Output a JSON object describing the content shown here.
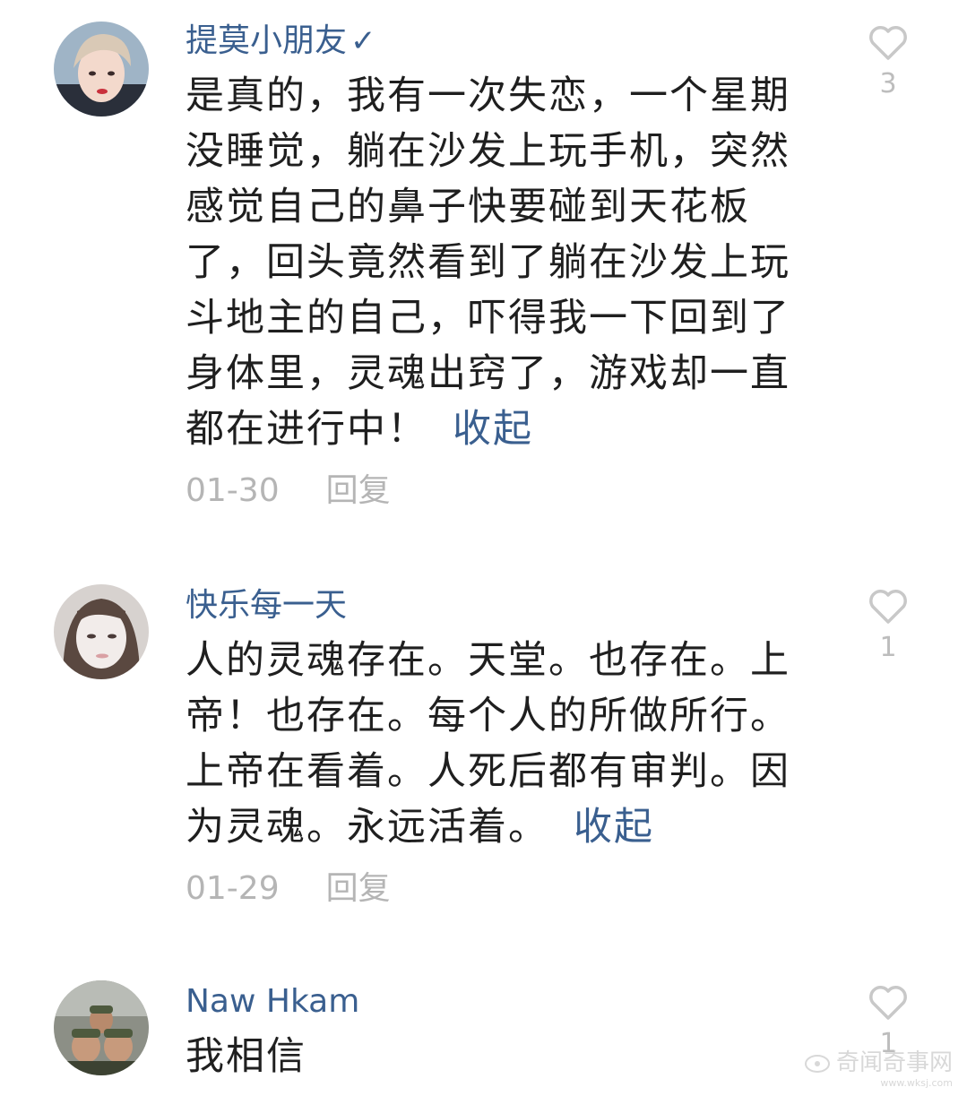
{
  "comments": [
    {
      "username": "提莫小朋友",
      "verified_mark": "✓",
      "text": "是真的，我有一次失恋，一个星期没睡觉，躺在沙发上玩手机，突然感觉自己的鼻子快要碰到天花板了，回头竟然看到了躺在沙发上玩斗地主的自己，吓得我一下回到了身体里，灵魂出窍了，游戏却一直都在进行中！",
      "collapse_label": "收起",
      "date": "01-30",
      "reply_label": "回复",
      "like_count": "3",
      "like_icon": "heart-outline-icon"
    },
    {
      "username": "快乐每一天",
      "text": "人的灵魂存在。天堂。也存在。上帝！也存在。每个人的所做所行。上帝在看着。人死后都有审判。因为灵魂。永远活着。",
      "collapse_label": "收起",
      "date": "01-29",
      "reply_label": "回复",
      "like_count": "1",
      "like_icon": "heart-outline-icon"
    },
    {
      "username": "Naw Hkam",
      "text": "我相信",
      "like_count": "1",
      "like_icon": "heart-outline-icon"
    }
  ],
  "watermark": {
    "text": "奇闻奇事网",
    "url": "www.wksj.com"
  },
  "colors": {
    "link": "#3a5f8f",
    "body_text": "#1f1f1f",
    "meta_text": "#b5b5b5",
    "icon": "#c8c8c8"
  }
}
